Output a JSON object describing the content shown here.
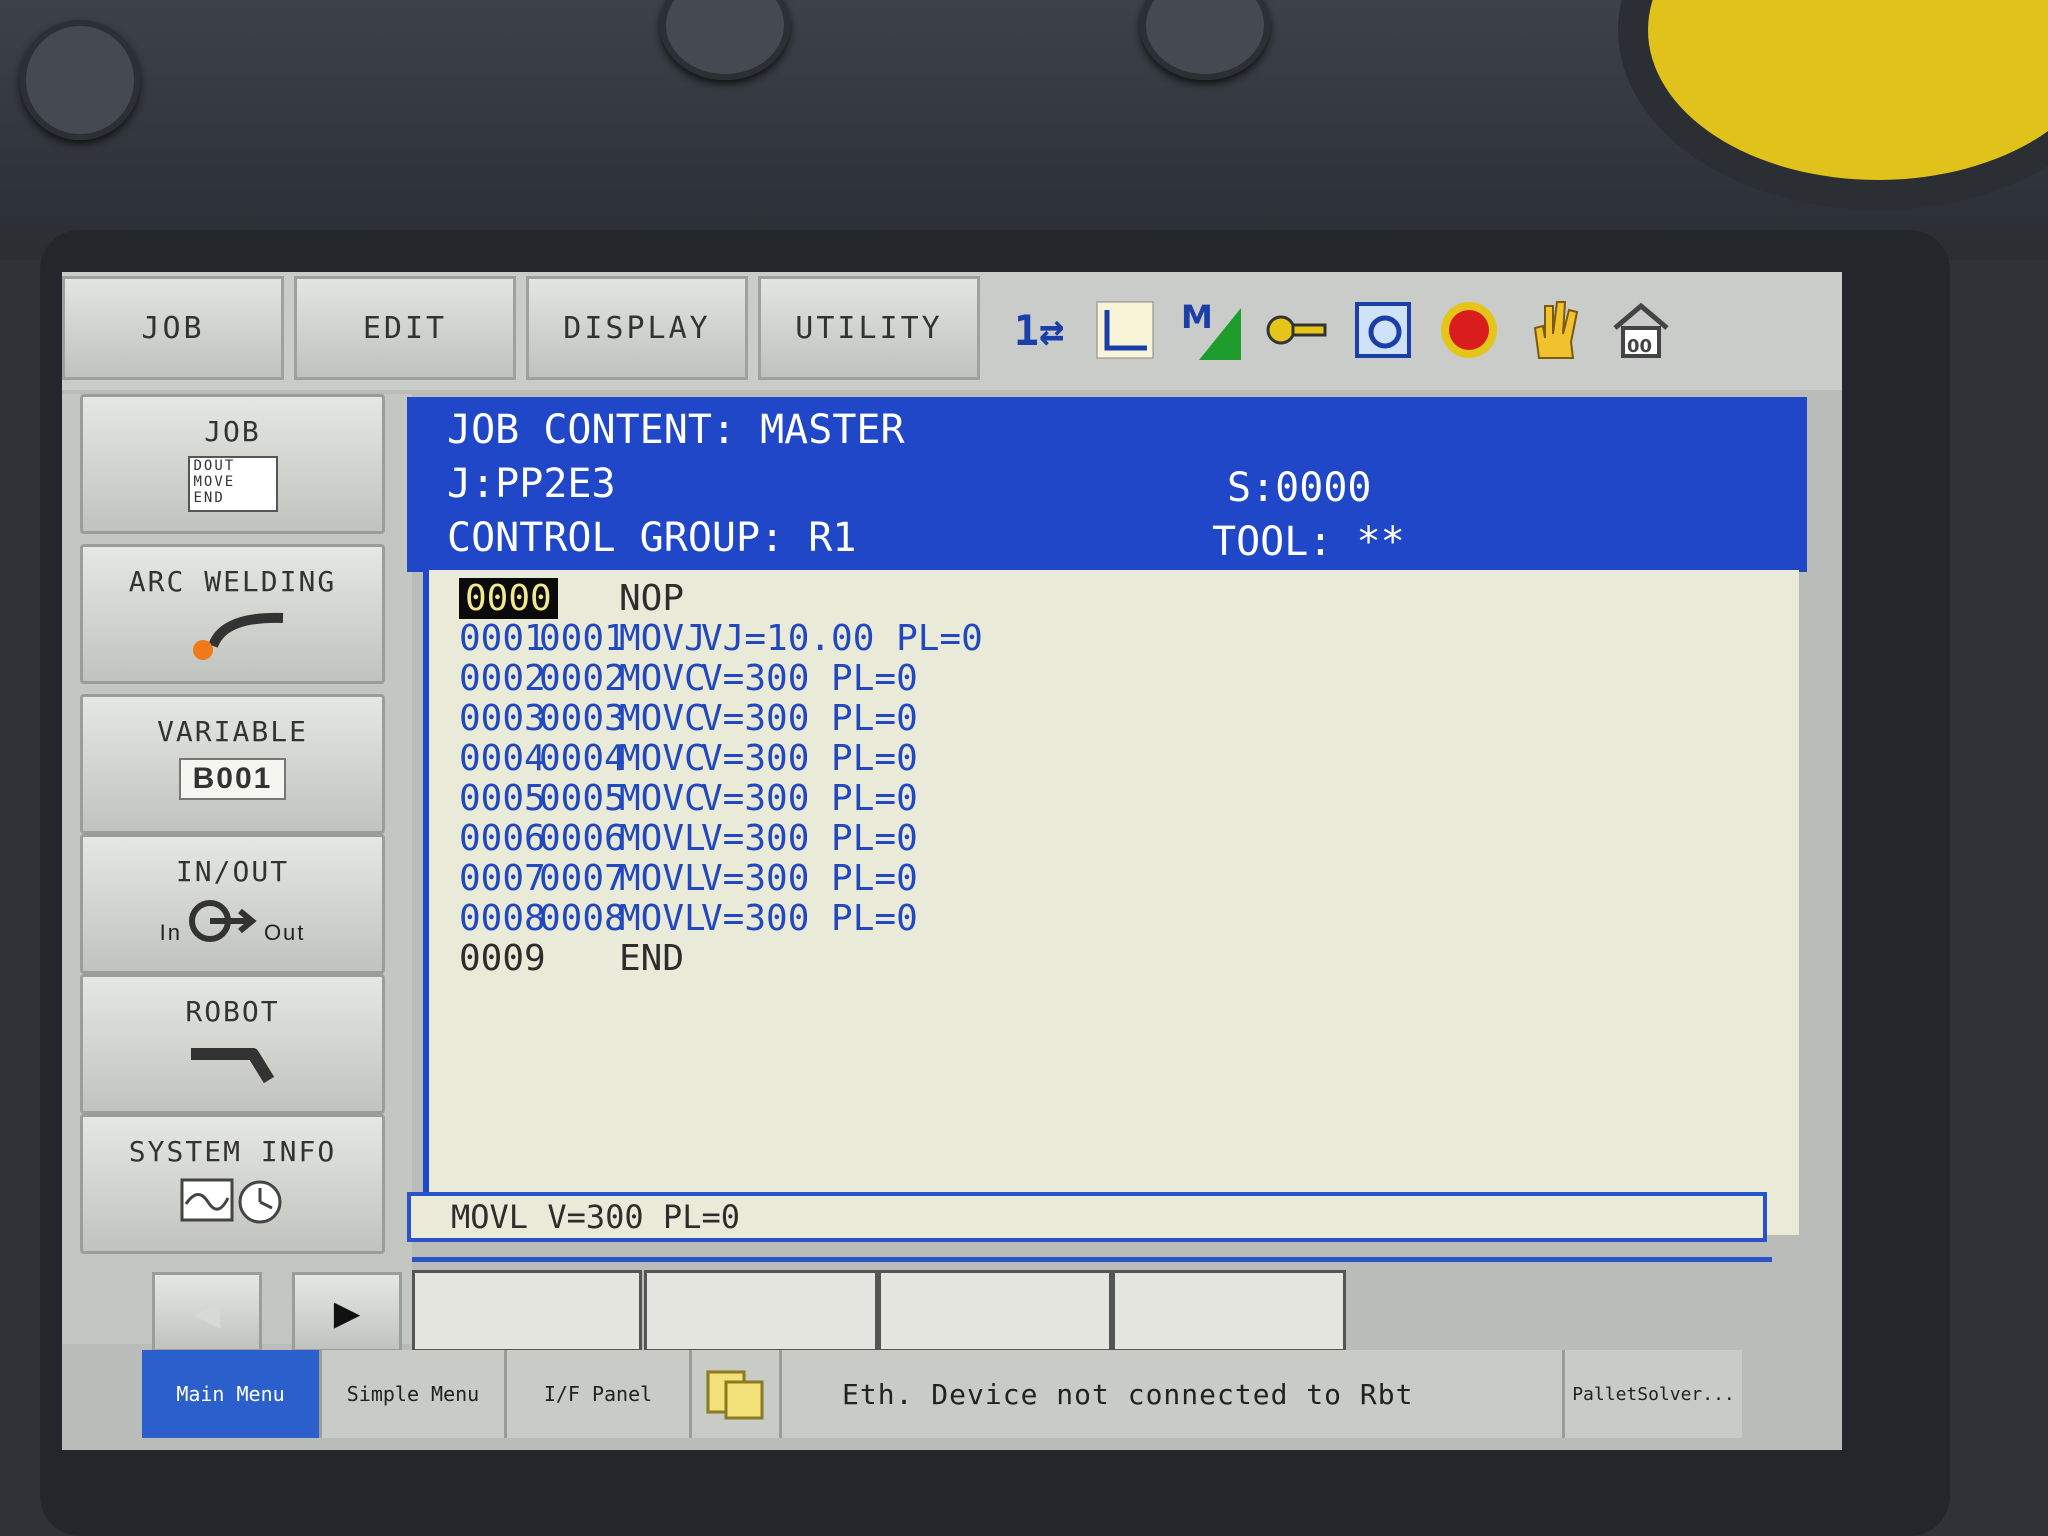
{
  "tabs": [
    "JOB",
    "EDIT",
    "DISPLAY",
    "UTILITY"
  ],
  "status_icons": [
    "coordinate-toggle-icon",
    "axis-icon",
    "speed-level-icon",
    "security-key-icon",
    "teach-mode-icon",
    "servo-stop-icon",
    "hand-icon",
    "home-icon"
  ],
  "side_menu": {
    "job": {
      "label": "JOB",
      "doc_lines": [
        "DOUT",
        "MOVE",
        "END"
      ]
    },
    "arc_welding": {
      "label": "ARC WELDING"
    },
    "variable": {
      "label": "VARIABLE",
      "box": "B001"
    },
    "in_out": {
      "label": "IN/OUT",
      "in": "In",
      "out": "Out"
    },
    "robot": {
      "label": "ROBOT"
    },
    "system_info": {
      "label": "SYSTEM INFO"
    }
  },
  "job_header": {
    "title": "JOB CONTENT: MASTER",
    "job_name": "J:PP2E3",
    "step": "S:0000",
    "control_group": "CONTROL GROUP: R1",
    "tool": "TOOL: **"
  },
  "job_lines": [
    {
      "line": "0000",
      "step": "",
      "instr": "NOP",
      "args": ""
    },
    {
      "line": "0001",
      "step": "0001",
      "instr": "MOVJ",
      "args": "VJ=10.00 PL=0"
    },
    {
      "line": "0002",
      "step": "0002",
      "instr": "MOVC",
      "args": "V=300 PL=0"
    },
    {
      "line": "0003",
      "step": "0003",
      "instr": "MOVC",
      "args": "V=300 PL=0"
    },
    {
      "line": "0004",
      "step": "0004",
      "instr": "MOVC",
      "args": "V=300 PL=0"
    },
    {
      "line": "0005",
      "step": "0005",
      "instr": "MOVC",
      "args": "V=300 PL=0"
    },
    {
      "line": "0006",
      "step": "0006",
      "instr": "MOVL",
      "args": "V=300 PL=0"
    },
    {
      "line": "0007",
      "step": "0007",
      "instr": "MOVL",
      "args": "V=300 PL=0"
    },
    {
      "line": "0008",
      "step": "0008",
      "instr": "MOVL",
      "args": "V=300 PL=0"
    },
    {
      "line": "0009",
      "step": "",
      "instr": "END",
      "args": ""
    }
  ],
  "edit_line": "MOVL V=300 PL=0",
  "bottom_bar": {
    "main_menu": "Main Menu",
    "simple_menu": "Simple Menu",
    "if_panel": "I/F Panel",
    "message": "Eth. Device not connected to Rbt",
    "app": "PalletSolver..."
  },
  "colors": {
    "header_blue": "#1f47c8",
    "list_bg": "#e9ead7",
    "instr_blue": "#2248c0",
    "estop_yellow": "#e0c21a",
    "active_tab": "#2a5fcc"
  }
}
